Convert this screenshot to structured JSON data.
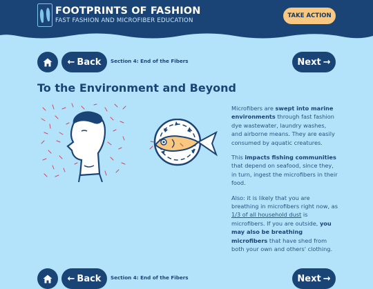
{
  "header": {
    "site_title": "FOOTPRINTS OF FASHION",
    "site_subtitle": "FAST FASHION AND MICROFIBER EDUCATION",
    "cta_label": "TAKE ACTION",
    "bg_color": "#1b4476",
    "cta_color": "#f9c780"
  },
  "nav": {
    "home_icon": "home-icon",
    "back_label": "Back",
    "back_arrow": "←",
    "section_label": "Section 4: End of the Fibers",
    "next_label": "Next",
    "next_arrow": "→"
  },
  "main": {
    "title": "To the Environment and Beyond",
    "paragraphs": [
      {
        "pre": "Microfibers are ",
        "highlight": "swept into marine environments",
        "post": " through fast fashion dye wastewater, laundry washes, and airborne means. They are easily consumed by aquatic creatures."
      },
      {
        "pre": "This ",
        "highlight": "impacts fishing communities",
        "post": " that depend on seafood, since they, in turn, ingest the microfibers in their food."
      },
      {
        "pre": "Also: it is likely that you are breathing in microfibers right now, as ",
        "link": "1/3 of all household dust",
        "mid": " is microfibers. If you are outside, ",
        "highlight": "you may also be breathing microfibers",
        "post": " that have shed from both your own and others' clothing."
      }
    ]
  },
  "colors": {
    "background": "#b3e3fb",
    "text": "#26557f",
    "fiber_red": "#d2475a"
  }
}
